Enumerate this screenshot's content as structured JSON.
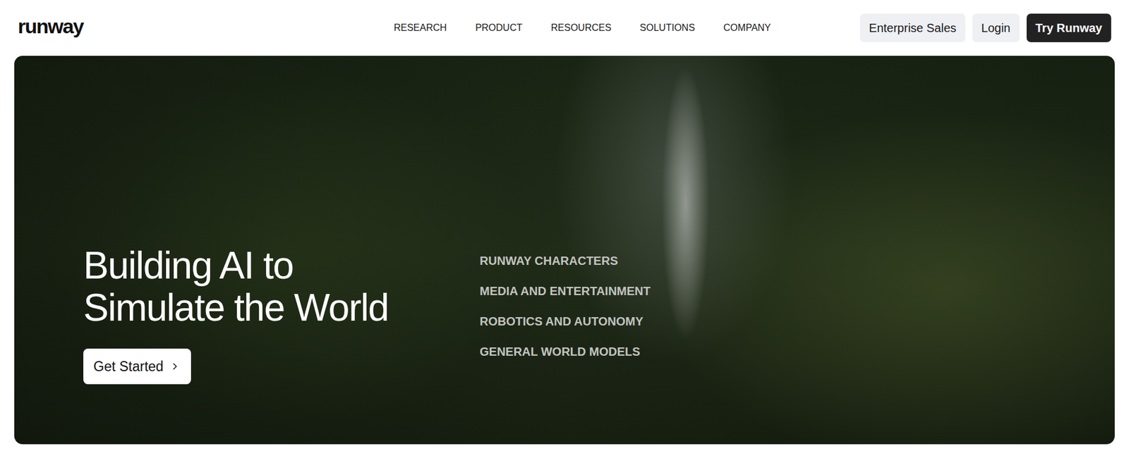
{
  "header": {
    "logo": "runway",
    "nav": [
      "RESEARCH",
      "PRODUCT",
      "RESOURCES",
      "SOLUTIONS",
      "COMPANY"
    ],
    "buttons": [
      {
        "label": "Enterprise Sales",
        "kind": "secondary"
      },
      {
        "label": "Login",
        "kind": "secondary"
      },
      {
        "label": "Try Runway",
        "kind": "primary"
      }
    ]
  },
  "hero": {
    "headline": [
      "Building AI to",
      "Simulate the World"
    ],
    "cta": "Get Started",
    "categories": [
      "RUNWAY CHARACTERS",
      "MEDIA AND ENTERTAINMENT",
      "ROBOTICS AND AUTONOMY",
      "GENERAL WORLD MODELS"
    ]
  }
}
